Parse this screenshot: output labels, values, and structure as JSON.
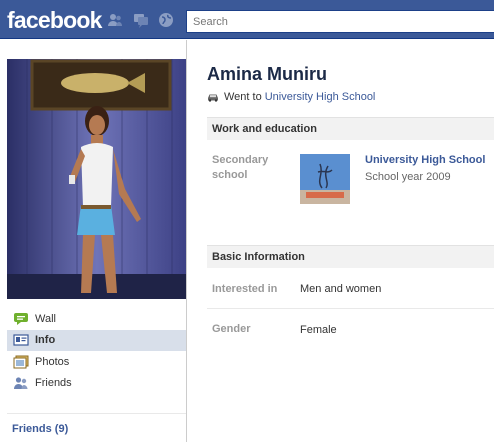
{
  "header": {
    "logo_text": "facebook",
    "search_placeholder": "Search",
    "jewels": [
      "friend-requests-icon",
      "messages-icon",
      "notifications-icon"
    ]
  },
  "sidebar": {
    "items": [
      {
        "label": "Wall",
        "icon": "wall-icon"
      },
      {
        "label": "Info",
        "icon": "info-icon"
      },
      {
        "label": "Photos",
        "icon": "photos-icon"
      },
      {
        "label": "Friends",
        "icon": "friends-icon"
      }
    ],
    "selected": "Info",
    "friends_count_label": "Friends (9)"
  },
  "profile": {
    "name": "Amina Muniru",
    "went_prefix": "Went to",
    "went_school": "University High School"
  },
  "sections": {
    "work_education": {
      "heading": "Work and education",
      "secondary_label": "Secondary school",
      "school_name": "University High School",
      "school_year": "School year 2009"
    },
    "basic_info": {
      "heading": "Basic Information",
      "interested_label": "Interested in",
      "interested_value": "Men and women",
      "gender_label": "Gender",
      "gender_value": "Female"
    }
  },
  "colors": {
    "brand_blue": "#3b5998",
    "selected_nav": "#d8dfea",
    "section_header": "#f2f2f2"
  }
}
